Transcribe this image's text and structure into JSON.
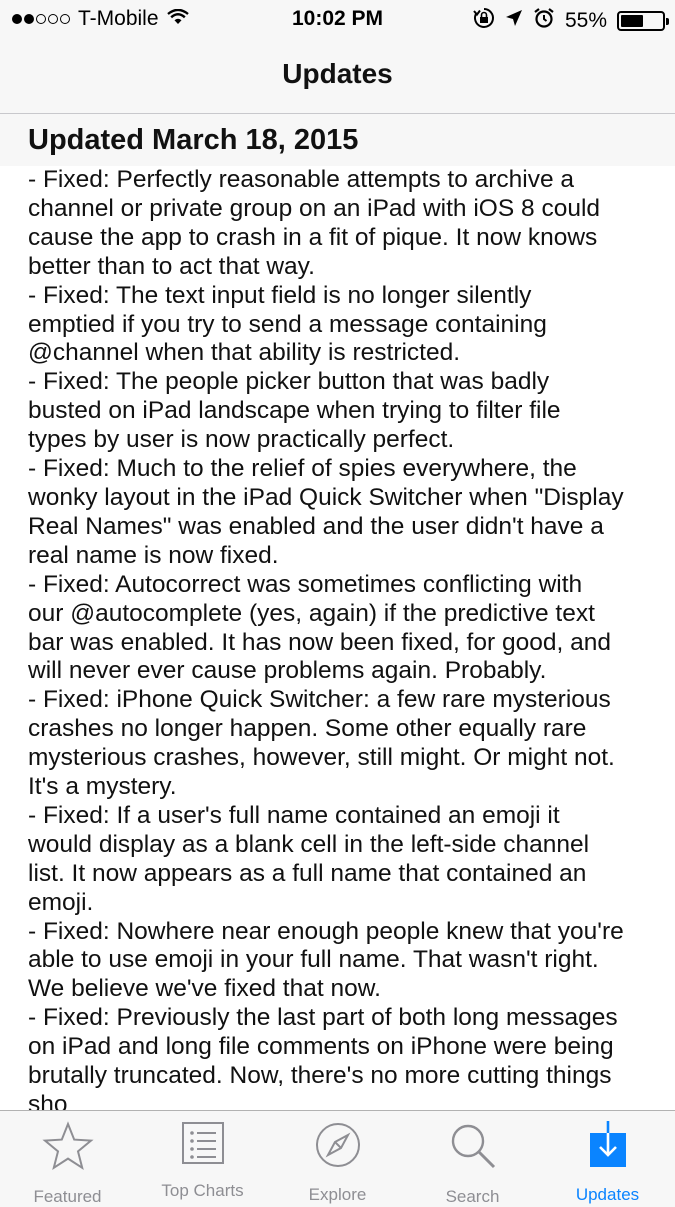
{
  "status_bar": {
    "carrier": "T-Mobile",
    "signal_dots_filled": 2,
    "signal_dots_total": 5,
    "time": "10:02 PM",
    "battery_percent": "55%",
    "battery_level": 0.55
  },
  "nav": {
    "title": "Updates"
  },
  "section": {
    "title": "Updated March 18, 2015"
  },
  "release_notes": [
    "- Fixed: Perfectly reasonable attempts to archive a",
    "channel or private group on an iPad with iOS 8 could",
    "cause the app to crash in a fit of pique. It now knows",
    "better than to act that way.",
    "- Fixed: The text input field is no longer silently",
    "emptied if you try to send a message containing",
    "@channel when that ability is restricted.",
    "- Fixed: The people picker button that was badly",
    "busted on iPad landscape when trying to filter file",
    "types by user is now practically perfect.",
    "- Fixed: Much to the relief of spies everywhere, the",
    "wonky layout in the iPad Quick Switcher when \"Display",
    "Real Names\" was enabled and the user didn't have a",
    "real name is now fixed.",
    "- Fixed: Autocorrect was sometimes conflicting with",
    "our @autocomplete (yes, again) if the predictive text",
    "bar was enabled. It has now been fixed, for good, and",
    "will never ever cause problems again. Probably.",
    "- Fixed: iPhone Quick Switcher: a few rare mysterious",
    "crashes no longer happen. Some other equally rare",
    "mysterious crashes, however, still might. Or might not.",
    "It's a mystery.",
    "- Fixed: If a user's full name contained an emoji it",
    "would display as a blank cell in the left-side channel",
    "list. It now appears as a full name that contained an",
    "emoji.",
    "- Fixed: Nowhere near enough people knew that you're",
    "able to use emoji in your full name. That wasn't right.",
    "We believe we've fixed that now.",
    "- Fixed: Previously the last part of both long messages",
    "on iPad and long file comments on iPhone were being",
    "brutally truncated. Now, there's no more cutting things",
    "sho"
  ],
  "tab_bar": {
    "active_color": "#0a84ff",
    "inactive_color": "#8e8e93",
    "tabs": [
      {
        "label": "Featured",
        "icon": "star-icon",
        "active": false
      },
      {
        "label": "Top Charts",
        "icon": "list-icon",
        "active": false
      },
      {
        "label": "Explore",
        "icon": "compass-icon",
        "active": false
      },
      {
        "label": "Search",
        "icon": "search-icon",
        "active": false
      },
      {
        "label": "Updates",
        "icon": "updates-download-icon",
        "active": true
      }
    ]
  }
}
